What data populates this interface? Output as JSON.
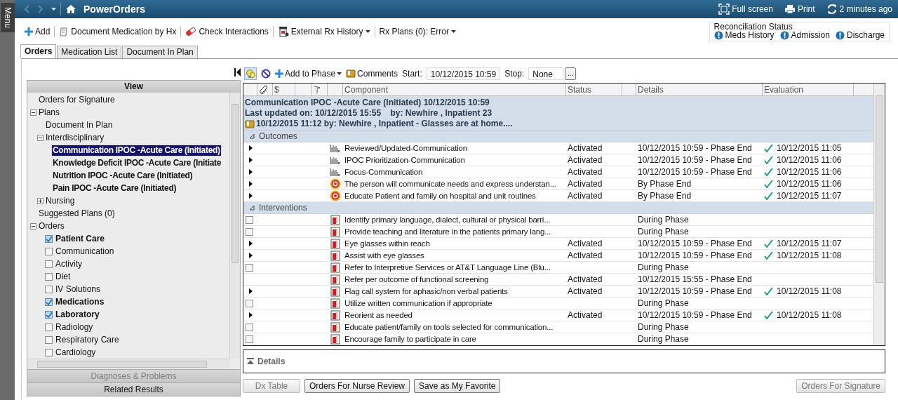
{
  "side_tab": {
    "label": "Menu"
  },
  "header": {
    "title": "PowerOrders",
    "actions": [
      {
        "kind": "fullscreen",
        "label": "Full screen"
      },
      {
        "kind": "print",
        "label": "Print"
      },
      {
        "kind": "refresh",
        "label": "2 minutes ago"
      }
    ]
  },
  "toolbar": [
    {
      "kind": "add",
      "label": "Add",
      "dropdown": false
    },
    {
      "kind": "document",
      "label": "Document Medication by Hx",
      "dropdown": false
    },
    {
      "kind": "interactions",
      "label": "Check Interactions",
      "dropdown": false
    },
    {
      "kind": "history",
      "label": "External Rx History",
      "dropdown": true
    },
    {
      "kind": "plain",
      "label": "Rx Plans (0): Error",
      "dropdown": true
    }
  ],
  "reconciliation": {
    "title": "Reconciliation Status",
    "items": [
      "Meds History",
      "Admission",
      "Discharge"
    ]
  },
  "tabs": [
    {
      "label": "Orders",
      "selected": true
    },
    {
      "label": "Medication List",
      "selected": false
    },
    {
      "label": "Document In Plan",
      "selected": false
    }
  ],
  "view_panel": {
    "title": "View",
    "tree": [
      {
        "label": "Orders for Signature"
      },
      {
        "label": "Plans",
        "expanded": true,
        "children": [
          {
            "label": "Document In Plan"
          },
          {
            "label": "Interdisciplinary",
            "expanded": true,
            "children": [
              {
                "label": "Communication IPOC -Acute Care (Initiated)",
                "selected": true
              },
              {
                "label": "Knowledge Deficit IPOC -Acute Care (Initiate",
                "selected": false
              },
              {
                "label": "Nutrition IPOC -Acute Care (Initiated)",
                "selected": false
              },
              {
                "label": "Pain IPOC -Acute Care (Initiated)",
                "selected": false
              }
            ]
          },
          {
            "label": "Nursing",
            "expanded": false
          }
        ]
      },
      {
        "label": "Suggested Plans (0)"
      },
      {
        "label": "Orders",
        "expanded": true,
        "children": [
          {
            "label": "Patient Care",
            "checked": true
          },
          {
            "label": "Communication",
            "checked": false
          },
          {
            "label": "Activity",
            "checked": false
          },
          {
            "label": "Diet",
            "checked": false
          },
          {
            "label": "IV Solutions",
            "checked": false
          },
          {
            "label": "Medications",
            "checked": true
          },
          {
            "label": "Laboratory",
            "checked": true
          },
          {
            "label": "Radiology",
            "checked": false
          },
          {
            "label": "Respiratory Care",
            "checked": false
          },
          {
            "label": "Cardiology",
            "checked": false
          }
        ]
      }
    ],
    "sections": [
      {
        "label": "Diagnoses & Problems",
        "disabled": true
      },
      {
        "label": "Related Results",
        "disabled": false
      }
    ]
  },
  "plan_toolbar": {
    "add_to_phase": "Add to Phase",
    "comments": "Comments",
    "start_label": "Start:",
    "start_value": "10/12/2015 10:59",
    "stop_label": "Stop:",
    "stop_value": "None",
    "more": "..."
  },
  "table": {
    "columns": [
      {
        "kind": "blank"
      },
      {
        "kind": "paperclip"
      },
      {
        "kind": "text",
        "label": "$"
      },
      {
        "kind": "blank"
      },
      {
        "kind": "flag"
      },
      {
        "kind": "blank"
      },
      {
        "kind": "text",
        "label": "Component"
      },
      {
        "kind": "text",
        "label": "Status"
      },
      {
        "kind": "blank"
      },
      {
        "kind": "text",
        "label": "Details"
      },
      {
        "kind": "text",
        "label": "Evaluation"
      }
    ],
    "plan_header": [
      "Communication IPOC -Acute Care (Initiated) 10/12/2015 10:59",
      "Last updated on: 10/12/2015 15:55    by: Newhire , Inpatient 23"
    ],
    "plan_comment": "10/12/2015 11:12 by: Newhire , Inpatient - Glasses are at home....",
    "groups": [
      {
        "title": "Outcomes",
        "rows": [
          {
            "kind": "measure",
            "expanded": false,
            "component": "Reviewed/Updated-Communication",
            "status": "Activated",
            "details": "10/12/2015 10:59 - Phase End",
            "evaluation": "10/12/2015 11:05"
          },
          {
            "kind": "measure",
            "expanded": false,
            "component": "IPOC Prioritization-Communication",
            "status": "Activated",
            "details": "10/12/2015 10:59 - Phase End",
            "evaluation": "10/12/2015 11:06"
          },
          {
            "kind": "measure",
            "expanded": false,
            "component": "Focus-Communication",
            "status": "Activated",
            "details": "10/12/2015 10:59 - Phase End",
            "evaluation": "10/12/2015 11:06"
          },
          {
            "kind": "goal",
            "expanded": false,
            "component": "The person will communicate needs and express understan...",
            "status": "Activated",
            "details": "By Phase End",
            "evaluation": "10/12/2015 11:06"
          },
          {
            "kind": "goal",
            "expanded": false,
            "component": "Educate Patient and family on hospital and unit routines",
            "status": "Activated",
            "details": "By Phase End",
            "evaluation": "10/12/2015 11:07"
          }
        ]
      },
      {
        "title": "Interventions",
        "rows": [
          {
            "kind": "intervention",
            "checked": false,
            "component": "Identify primary language, dialect, cultural or physical barri...",
            "details": "During Phase"
          },
          {
            "kind": "intervention",
            "checked": false,
            "component": "Provide teaching and literature in the patients primary lang...",
            "details": "During Phase"
          },
          {
            "kind": "intervention",
            "expanded": false,
            "component": "Eye glasses within reach",
            "status": "Activated",
            "details": "10/12/2015 10:59 - Phase End",
            "evaluation": "10/12/2015 11:07"
          },
          {
            "kind": "intervention",
            "expanded": false,
            "component": "Assist with eye glasses",
            "status": "Activated",
            "details": "10/12/2015 10:59 - Phase End",
            "evaluation": "10/12/2015 11:08"
          },
          {
            "kind": "intervention",
            "checked": false,
            "component": "Refer to Interpretive Services or AT&T Language Line (Blu...",
            "details": "During Phase"
          },
          {
            "kind": "intervention",
            "component": "Refer per outcome of functional screening",
            "status": "Activated",
            "details": "10/12/2015 15:55 - Phase End"
          },
          {
            "kind": "intervention",
            "expanded": false,
            "component": "Flag call system for aphasic/non verbal patients",
            "status": "Activated",
            "details": "10/12/2015 10:59 - Phase End",
            "evaluation": "10/12/2015 11:08"
          },
          {
            "kind": "intervention",
            "checked": false,
            "component": "Utilize written communication if appropriate",
            "details": "During Phase"
          },
          {
            "kind": "intervention",
            "expanded": false,
            "component": "Reorient as needed",
            "status": "Activated",
            "details": "10/12/2015 10:59 - Phase End",
            "evaluation": "10/12/2015 11:08"
          },
          {
            "kind": "intervention",
            "checked": false,
            "component": "Educate patient/family on tools selected for communication...",
            "details": "During Phase"
          },
          {
            "kind": "intervention",
            "checked": false,
            "component": "Encourage family to participate in care",
            "details": "During Phase"
          }
        ]
      }
    ]
  },
  "details": {
    "title": "Details"
  },
  "buttons_left": [
    {
      "label": "Dx Table",
      "disabled": true
    },
    {
      "label": "Orders For Nurse Review",
      "disabled": false
    },
    {
      "label": "Save as My Favorite",
      "disabled": false
    }
  ],
  "buttons_right": [
    {
      "label": "Orders For Signature",
      "disabled": true
    }
  ]
}
